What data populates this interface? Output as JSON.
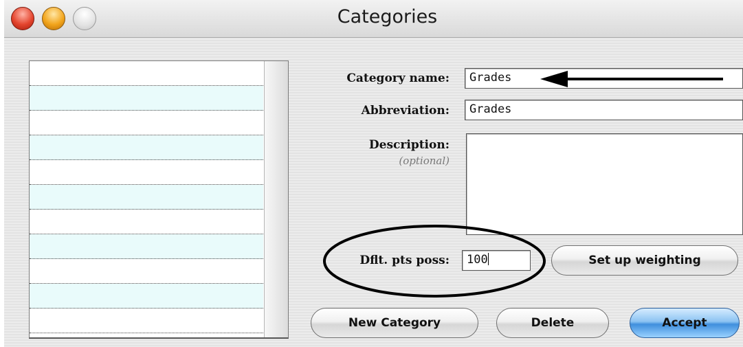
{
  "window": {
    "title": "Categories"
  },
  "form": {
    "category_name_label": "Category name:",
    "category_name_value": "Grades",
    "abbreviation_label": "Abbreviation:",
    "abbreviation_value": "Grades",
    "description_label": "Description:",
    "description_optional": "(optional)",
    "description_value": "",
    "default_points_label": "Dflt. pts poss:",
    "default_points_value": "100"
  },
  "buttons": {
    "set_up_weighting": "Set up weighting",
    "new_category": "New Category",
    "delete": "Delete",
    "accept": "Accept"
  },
  "category_list": {
    "items": []
  }
}
